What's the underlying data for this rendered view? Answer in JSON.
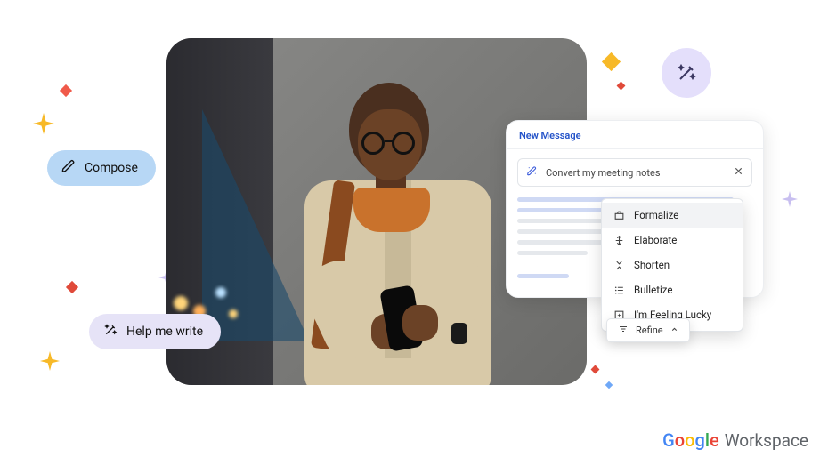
{
  "compose_pill": {
    "label": "Compose"
  },
  "help_pill": {
    "label": "Help me write"
  },
  "panel": {
    "title": "New Message",
    "prompt": "Convert my meeting notes"
  },
  "menu": {
    "items": [
      {
        "label": "Formalize"
      },
      {
        "label": "Elaborate"
      },
      {
        "label": "Shorten"
      },
      {
        "label": "Bulletize"
      },
      {
        "label": "I'm Feeling Lucky"
      }
    ]
  },
  "refine": {
    "label": "Refine"
  },
  "brand": {
    "google": "Google",
    "workspace": "Workspace"
  }
}
